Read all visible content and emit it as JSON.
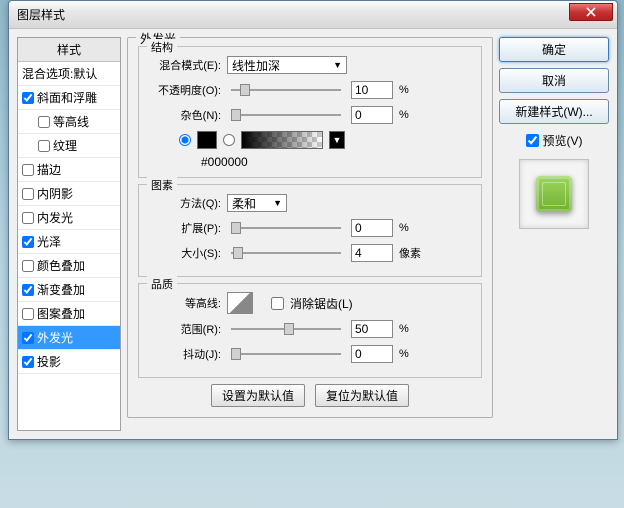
{
  "window": {
    "title": "图层样式"
  },
  "styles": {
    "header": "样式",
    "blend_default": "混合选项:默认",
    "items": [
      {
        "label": "斜面和浮雕",
        "checked": true,
        "indent": false
      },
      {
        "label": "等高线",
        "checked": false,
        "indent": true
      },
      {
        "label": "纹理",
        "checked": false,
        "indent": true
      },
      {
        "label": "描边",
        "checked": false,
        "indent": false
      },
      {
        "label": "内阴影",
        "checked": false,
        "indent": false
      },
      {
        "label": "内发光",
        "checked": false,
        "indent": false
      },
      {
        "label": "光泽",
        "checked": true,
        "indent": false
      },
      {
        "label": "颜色叠加",
        "checked": false,
        "indent": false
      },
      {
        "label": "渐变叠加",
        "checked": true,
        "indent": false
      },
      {
        "label": "图案叠加",
        "checked": false,
        "indent": false
      },
      {
        "label": "外发光",
        "checked": true,
        "indent": false,
        "selected": true
      },
      {
        "label": "投影",
        "checked": true,
        "indent": false
      }
    ]
  },
  "outer_glow": {
    "title": "外发光",
    "structure": {
      "legend": "结构",
      "blend_mode_label": "混合模式(E):",
      "blend_mode_value": "线性加深",
      "opacity_label": "不透明度(O):",
      "opacity_value": "10",
      "opacity_unit": "%",
      "noise_label": "杂色(N):",
      "noise_value": "0",
      "noise_unit": "%",
      "hex": "#000000"
    },
    "elements": {
      "legend": "图素",
      "technique_label": "方法(Q):",
      "technique_value": "柔和",
      "spread_label": "扩展(P):",
      "spread_value": "0",
      "spread_unit": "%",
      "size_label": "大小(S):",
      "size_value": "4",
      "size_unit": "像素"
    },
    "quality": {
      "legend": "品质",
      "contour_label": "等高线:",
      "antialias_label": "消除锯齿(L)",
      "range_label": "范围(R):",
      "range_value": "50",
      "range_unit": "%",
      "jitter_label": "抖动(J):",
      "jitter_value": "0",
      "jitter_unit": "%"
    },
    "buttons": {
      "make_default": "设置为默认值",
      "reset_default": "复位为默认值"
    }
  },
  "right": {
    "ok": "确定",
    "cancel": "取消",
    "new_style": "新建样式(W)...",
    "preview": "预览(V)"
  }
}
